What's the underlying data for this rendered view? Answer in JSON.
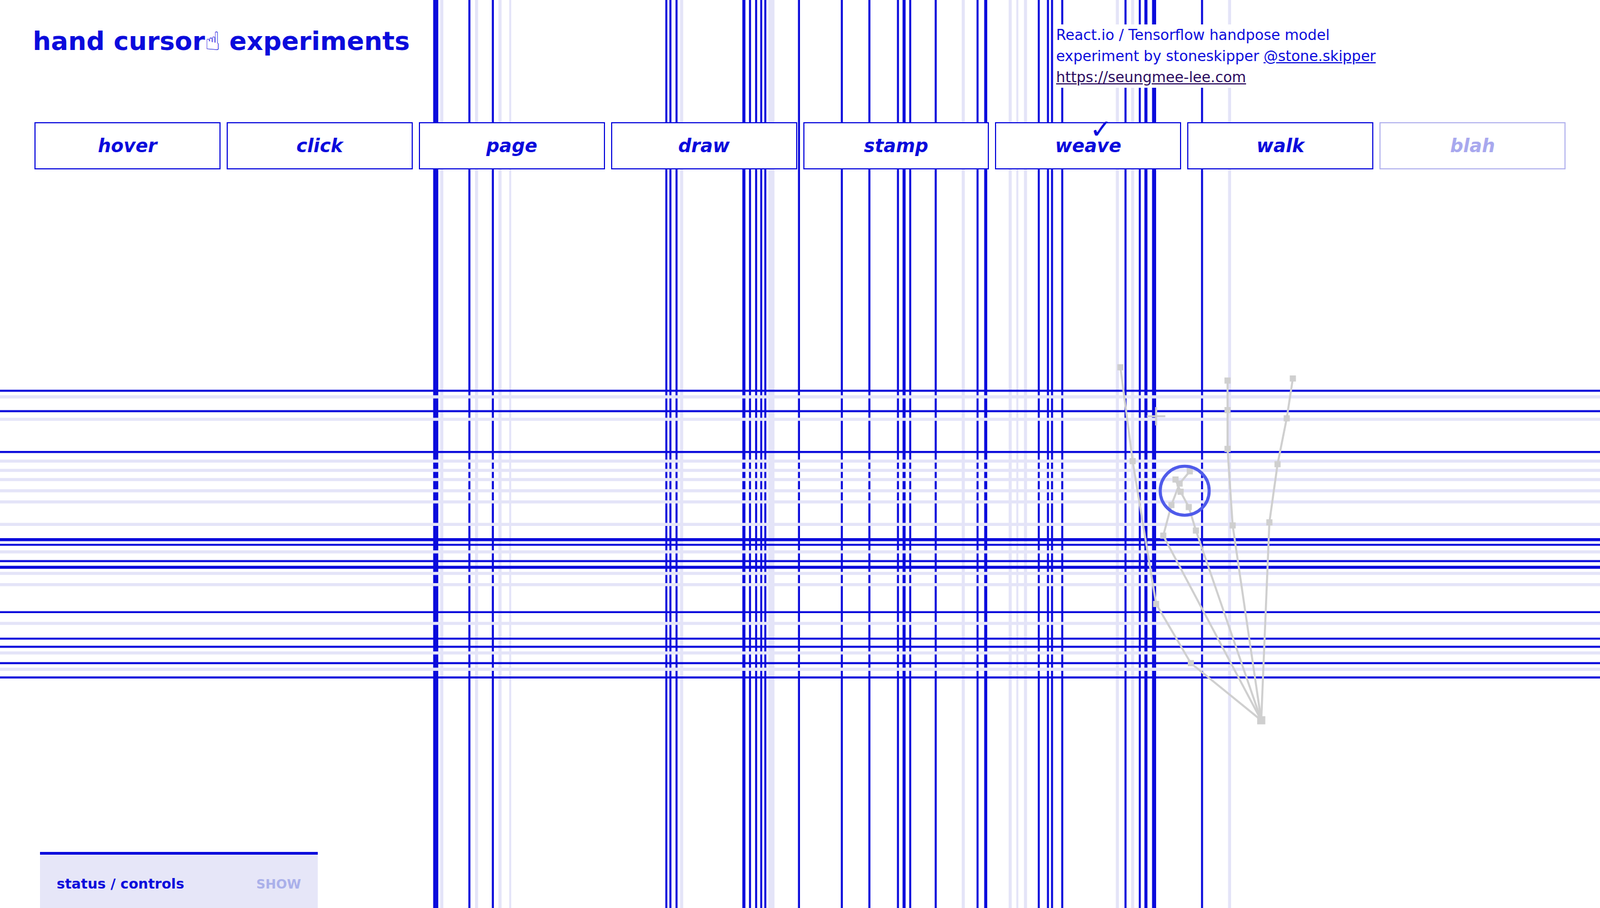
{
  "header": {
    "title": "hand cursor☝ experiments",
    "info": {
      "stack": "React.io / Tensorflow handpose model",
      "credit": "experiment by stoneskipper",
      "handle": "@stone.skipper",
      "url": "https://seungmee-lee.com"
    }
  },
  "tabs": {
    "selected_mark": "✓",
    "items": [
      {
        "label": "hover",
        "selected": false,
        "disabled": false
      },
      {
        "label": "click",
        "selected": false,
        "disabled": false
      },
      {
        "label": "page",
        "selected": false,
        "disabled": false
      },
      {
        "label": "draw",
        "selected": false,
        "disabled": false
      },
      {
        "label": "stamp",
        "selected": false,
        "disabled": false
      },
      {
        "label": "weave",
        "selected": true,
        "disabled": false
      },
      {
        "label": "walk",
        "selected": false,
        "disabled": false
      },
      {
        "label": "blah",
        "selected": false,
        "disabled": true
      }
    ]
  },
  "status_panel": {
    "title": "status / controls",
    "toggle": "SHOW",
    "expanded": false
  }
}
